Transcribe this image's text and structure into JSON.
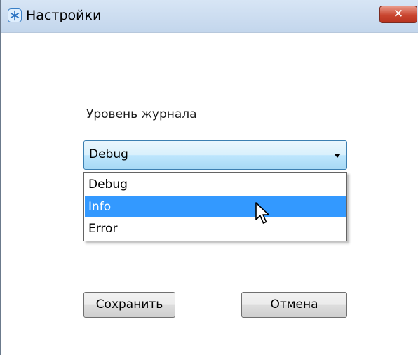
{
  "window": {
    "title": "Настройки",
    "close_label": "✕"
  },
  "settings": {
    "log_level_label": "Уровень журнала",
    "log_level_value": "Debug",
    "options": [
      "Debug",
      "Info",
      "Error"
    ],
    "hovered_option": "Info"
  },
  "buttons": {
    "save_label": "Сохранить",
    "cancel_label": "Отмена"
  },
  "icons": {
    "app": "snowflake-icon",
    "close": "close-icon",
    "dropdown": "chevron-down-icon",
    "cursor": "mouse-pointer-icon"
  },
  "colors": {
    "selection": "#3399ff",
    "close_button": "#c9452f",
    "combo_border": "#3c7fb1"
  }
}
